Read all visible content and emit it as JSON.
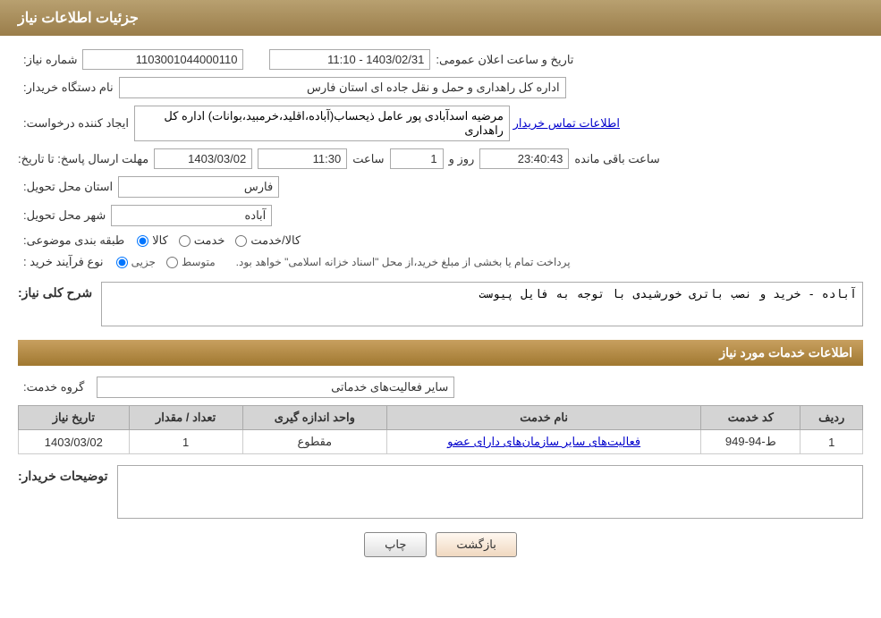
{
  "header": {
    "title": "جزئیات اطلاعات نیاز"
  },
  "form": {
    "need_number_label": "شماره نیاز:",
    "need_number_value": "1103001044000110",
    "buying_org_label": "نام دستگاه خریدار:",
    "buying_org_value": "اداره کل راهداری و حمل و نقل جاده ای استان فارس",
    "creator_label": "ایجاد کننده درخواست:",
    "creator_value": "مرضیه اسدآبادی پور عامل ذیحساب(آباده،اقلید،خرمبید،بوانات) اداره کل راهداری",
    "contact_link": "اطلاعات تماس خریدار",
    "deadline_label": "مهلت ارسال پاسخ: تا تاریخ:",
    "deadline_date": "1403/03/02",
    "deadline_time_label": "ساعت",
    "deadline_time": "11:30",
    "deadline_day_label": "روز و",
    "deadline_days": "1",
    "deadline_remaining_label": "ساعت باقی مانده",
    "deadline_remaining": "23:40:43",
    "announce_label": "تاریخ و ساعت اعلان عمومی:",
    "announce_value": "1403/02/31 - 11:10",
    "province_label": "استان محل تحویل:",
    "province_value": "فارس",
    "city_label": "شهر محل تحویل:",
    "city_value": "آباده",
    "category_label": "طبقه بندی موضوعی:",
    "category_kala": "کالا",
    "category_khadamat": "خدمت",
    "category_kala_khadamat": "کالا/خدمت",
    "process_label": "نوع فرآیند خرید :",
    "process_jazee": "جزیی",
    "process_motavasset": "متوسط",
    "process_note": "پرداخت تمام یا بخشی از مبلغ خرید،از محل \"اسناد خزانه اسلامی\" خواهد بود.",
    "need_description_label": "شرح کلی نیاز:",
    "need_description_value": "آباده - خرید و نصب باتری خورشیدی با توجه به فایل پیوست",
    "services_section_title": "اطلاعات خدمات مورد نیاز",
    "service_group_label": "گروه خدمت:",
    "service_group_value": "سایر فعالیت‌های خدماتی",
    "table": {
      "headers": [
        "ردیف",
        "کد خدمت",
        "نام خدمت",
        "واحد اندازه گیری",
        "تعداد / مقدار",
        "تاریخ نیاز"
      ],
      "rows": [
        {
          "row": "1",
          "code": "ط-94-949",
          "name": "فعالیت‌های سایر سازمان‌های دارای عضو",
          "unit": "مقطوع",
          "quantity": "1",
          "date": "1403/03/02"
        }
      ]
    },
    "buyer_notes_label": "توضیحات خریدار:",
    "buyer_notes_value": "",
    "btn_print": "چاپ",
    "btn_back": "بازگشت"
  }
}
